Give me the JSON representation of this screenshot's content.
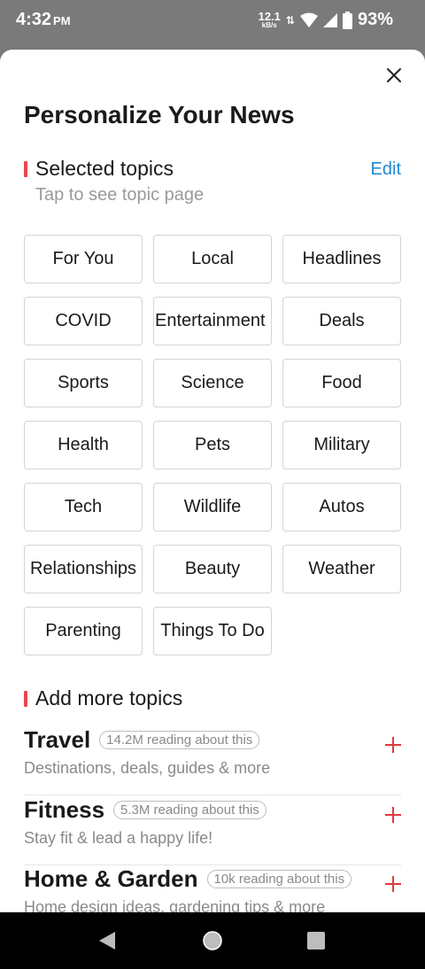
{
  "status": {
    "time": "4:32",
    "ampm": "PM",
    "net_speed": "12.1",
    "net_unit": "kB/s",
    "battery": "93%"
  },
  "header": {
    "title": "Personalize Your News",
    "close_icon": "close-icon"
  },
  "selected": {
    "heading": "Selected topics",
    "edit_label": "Edit",
    "subtitle": "Tap to see topic page",
    "topics": [
      "For You",
      "Local",
      "Headlines",
      "COVID",
      "Entertainment",
      "Deals",
      "Sports",
      "Science",
      "Food",
      "Health",
      "Pets",
      "Military",
      "Tech",
      "Wildlife",
      "Autos",
      "Relationships",
      "Beauty",
      "Weather",
      "Parenting",
      "Things To Do"
    ]
  },
  "add_more": {
    "heading": "Add more topics",
    "items": [
      {
        "name": "Travel",
        "readers": "14.2M reading about this",
        "desc": "Destinations, deals, guides & more"
      },
      {
        "name": "Fitness",
        "readers": "5.3M reading about this",
        "desc": "Stay fit & lead a happy life!"
      },
      {
        "name": "Home & Garden",
        "readers": "10k reading about this",
        "desc": "Home design ideas, gardening tips & more"
      }
    ]
  },
  "colors": {
    "accent": "#e8474c",
    "link": "#1e88d4",
    "plus": "#e0393e"
  },
  "nav": {
    "back_icon": "back-triangle-icon",
    "home_icon": "home-circle-icon",
    "recent_icon": "recent-square-icon"
  }
}
